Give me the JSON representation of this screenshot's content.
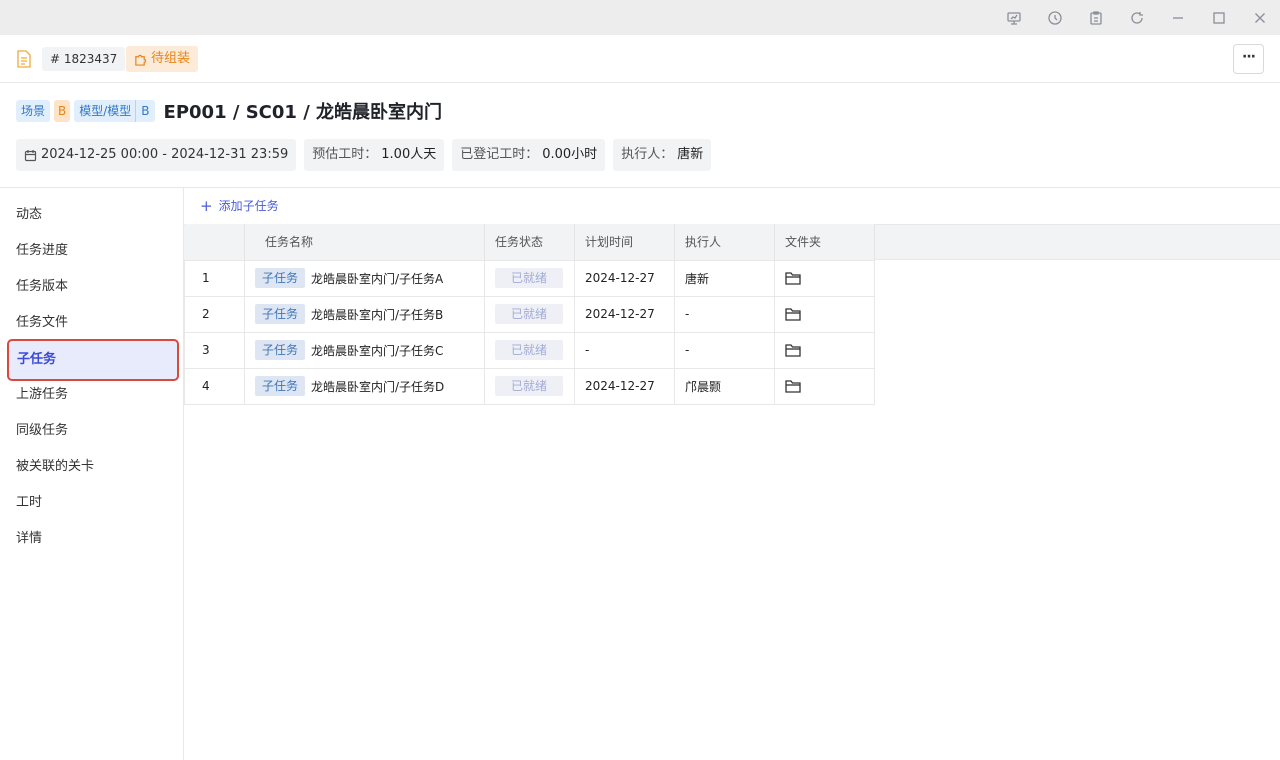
{
  "header": {
    "task_id": "# 1823437",
    "status": "待组装",
    "more": "···"
  },
  "tags": {
    "scene": "场景",
    "scene_level": "B",
    "model": "模型/模型",
    "model_level": "B"
  },
  "title": "EP001 / SC01 / 龙皓晨卧室内门",
  "meta": {
    "date_range": "2024-12-25 00:00 - 2024-12-31 23:59",
    "est_label": "预估工时：",
    "est_value": "1.00人天",
    "logged_label": "已登记工时：",
    "logged_value": "0.00小时",
    "exec_label": "执行人：",
    "exec_value": "唐新"
  },
  "sidebar": {
    "items": [
      "动态",
      "任务进度",
      "任务版本",
      "任务文件",
      "子任务",
      "上游任务",
      "同级任务",
      "被关联的关卡",
      "工时",
      "详情"
    ],
    "active": "子任务"
  },
  "add_subtask": "添加子任务",
  "table": {
    "columns": [
      "任务名称",
      "任务状态",
      "计划时间",
      "执行人",
      "文件夹"
    ],
    "rows": [
      {
        "idx": "1",
        "tag": "子任务",
        "name": "龙皓晨卧室内门/子任务A",
        "status": "已就绪",
        "time": "2024-12-27",
        "exec": "唐新"
      },
      {
        "idx": "2",
        "tag": "子任务",
        "name": "龙皓晨卧室内门/子任务B",
        "status": "已就绪",
        "time": "2024-12-27",
        "exec": "-"
      },
      {
        "idx": "3",
        "tag": "子任务",
        "name": "龙皓晨卧室内门/子任务C",
        "status": "已就绪",
        "time": "-",
        "exec": "-"
      },
      {
        "idx": "4",
        "tag": "子任务",
        "name": "龙皓晨卧室内门/子任务D",
        "status": "已就绪",
        "time": "2024-12-27",
        "exec": "邝晨颢"
      }
    ]
  },
  "icons": {
    "titlebar": [
      "presentation-icon",
      "history-icon",
      "clipboard-icon",
      "refresh-icon",
      "minimize-icon",
      "maximize-icon",
      "close-icon"
    ],
    "folder": "folder-icon"
  },
  "colors": {
    "accent": "#4a5bd9",
    "status_orange": "#e8841a",
    "active_border": "#d94a3d"
  }
}
